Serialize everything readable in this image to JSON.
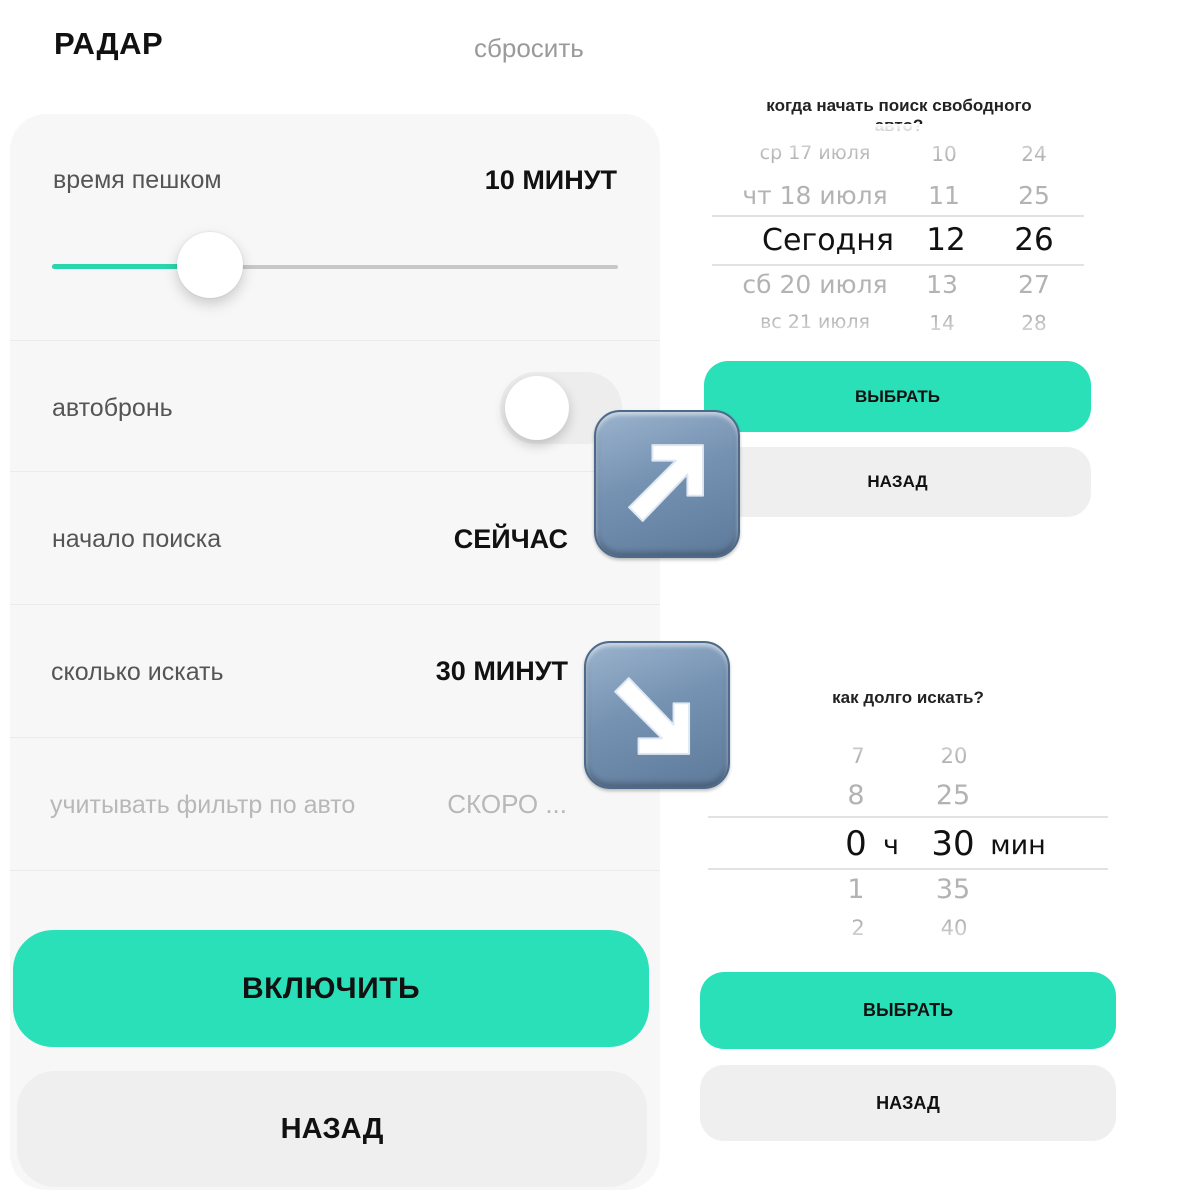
{
  "header": {
    "title": "РАДАР",
    "reset_label": "сбросить"
  },
  "settings": {
    "walk_time": {
      "label": "время пешком",
      "value": "10 МИНУТ",
      "slider_level": 0.28
    },
    "autobook": {
      "label": "автобронь",
      "enabled": false
    },
    "search_start": {
      "label": "начало поиска",
      "value": "СЕЙЧАС"
    },
    "search_duration": {
      "label": "сколько искать",
      "value": "30 МИНУТ"
    },
    "car_filter": {
      "label": "учитывать фильтр по авто",
      "value": "СКОРО ..."
    }
  },
  "main_buttons": {
    "enable_label": "ВКЛЮЧИТЬ",
    "back_label": "НАЗАД"
  },
  "start_picker": {
    "question": "когда начать поиск свободного авто?",
    "days": [
      "ср 17 июля",
      "чт 18 июля",
      "Сегодня",
      "сб 20 июля",
      "вс 21 июля"
    ],
    "hours": [
      "10",
      "11",
      "12",
      "13",
      "14"
    ],
    "minutes": [
      "24",
      "25",
      "26",
      "27",
      "28"
    ],
    "select_label": "ВЫБРАТЬ",
    "back_label": "НАЗАД"
  },
  "duration_picker": {
    "question": "как долго искать?",
    "hours": [
      "7",
      "8",
      "0",
      "1",
      "2"
    ],
    "hours_unit": "ч",
    "minutes": [
      "20",
      "25",
      "30",
      "35",
      "40"
    ],
    "minutes_unit": "мин",
    "select_label": "ВЫБРАТЬ",
    "back_label": "НАЗАД"
  },
  "colors": {
    "accent": "#2ae0b9",
    "slider_fill": "#2ad6ad",
    "arrow_tile": "#7592b2"
  },
  "icons": {
    "arrow_up_right": "arrow-up-right-icon",
    "arrow_down_right": "arrow-down-right-icon"
  }
}
